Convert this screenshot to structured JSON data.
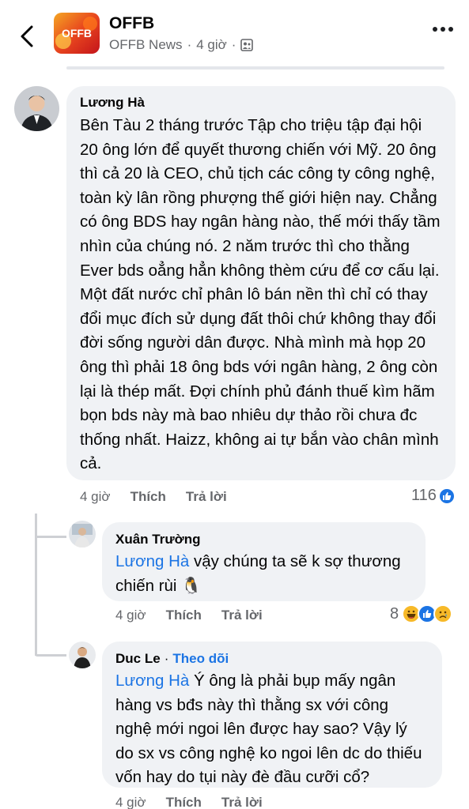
{
  "header": {
    "page_name": "OFFB",
    "source": "OFFB News",
    "separator": "·",
    "time": "4 giờ",
    "logo_text": "OFFB"
  },
  "comments": [
    {
      "author": "Lương Hà",
      "text": "Bên Tàu 2 tháng trước Tập cho triệu tập đại hội 20 ông lớn để quyết thương chiến với Mỹ. 20 ông thì cả 20 là CEO, chủ tịch các công ty công nghệ, toàn kỳ lân rồng phượng thế giới hiện nay. Chẳng có ông BDS hay ngân hàng nào, thế mới thấy tầm nhìn của chúng nó. 2 năm trước thì cho thằng Ever bds oẳng hẳn không thèm cứu để cơ cấu lại. Một đất nước chỉ phân lô bán nền thì chỉ có thay đổi mục đích sử dụng đất thôi chứ không thay đổi đời sống người dân được. Nhà mình mà họp 20 ông thì phải 18 ông bds với ngân hàng, 2 ông còn lại là thép mất. Đợi chính phủ đánh thuế kìm hãm bọn bds này mà bao nhiêu dự thảo rồi chưa đc thống nhất. Haizz, không ai tự bắn vào chân mình cả.",
      "time": "4 giờ",
      "like_label": "Thích",
      "reply_label": "Trả lời",
      "reaction_count": "116"
    },
    {
      "author": "Xuân Trường",
      "mention": "Lương Hà",
      "text": " vậy chúng ta sẽ k sợ thương chiến rùi 🐧",
      "time": "4 giờ",
      "like_label": "Thích",
      "reply_label": "Trả lời",
      "reaction_count": "8"
    },
    {
      "author": "Duc Le",
      "separator": "·",
      "follow_label": "Theo dõi",
      "mention": "Lương Hà",
      "text": " Ý ông là phải bụp mấy ngân hàng vs bđs này thì thằng sx với công nghệ mới ngoi lên được hay sao? Vậy lý do sx vs công nghệ ko ngoi lên dc do thiếu vốn hay do tụi này đè đầu cưỡi cổ?",
      "time": "4 giờ",
      "like_label": "Thích",
      "reply_label": "Trả lời"
    }
  ],
  "colors": {
    "link": "#1b74e4",
    "bubble": "#f0f2f5",
    "secondary": "#65676b"
  }
}
